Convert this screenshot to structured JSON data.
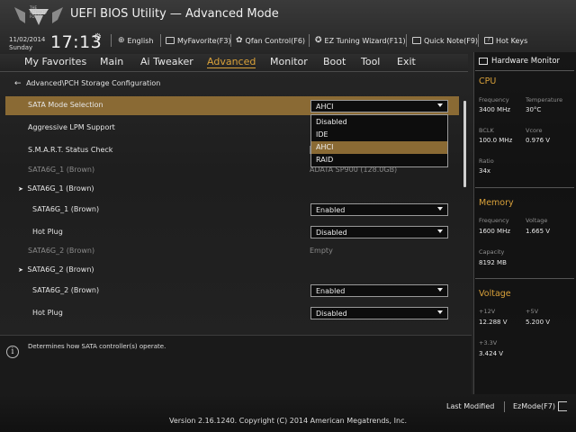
{
  "header": {
    "logo_text": "THE ULTIMATE FORCE",
    "app_title": "UEFI BIOS Utility — Advanced Mode",
    "date": "11/02/2014",
    "day": "Sunday",
    "time": "17:13",
    "items": [
      {
        "icon": "globe-icon",
        "label": "English"
      },
      {
        "icon": "my-favorite-icon",
        "label": "MyFavorite(F3)"
      },
      {
        "icon": "fan-icon",
        "label": "Qfan Control(F6)"
      },
      {
        "icon": "ez-tuning-icon",
        "label": "EZ Tuning Wizard(F11)"
      },
      {
        "icon": "quick-note-icon",
        "label": "Quick Note(F9)"
      },
      {
        "icon": "hot-keys-icon",
        "label": "Hot Keys"
      }
    ]
  },
  "nav": {
    "tabs": [
      "My Favorites",
      "Main",
      "Ai Tweaker",
      "Advanced",
      "Monitor",
      "Boot",
      "Tool",
      "Exit"
    ],
    "active": "Advanced"
  },
  "main": {
    "breadcrumb": "Advanced\\PCH Storage Configuration",
    "rows": [
      {
        "label": "SATA Mode Selection",
        "value": "AHCI"
      },
      {
        "label": "Aggressive LPM Support"
      },
      {
        "label": "S.M.A.R.T. Status Check"
      },
      {
        "label": "SATA6G_1 (Brown)",
        "value": "ADATA SP900 (128.0GB)"
      },
      {
        "label": "SATA6G_1 (Brown)"
      },
      {
        "label": "SATA6G_1 (Brown)",
        "value": "Enabled"
      },
      {
        "label": "Hot Plug",
        "value": "Disabled"
      },
      {
        "label": "SATA6G_2 (Brown)",
        "value": "Empty"
      },
      {
        "label": "SATA6G_2 (Brown)"
      },
      {
        "label": "SATA6G_2 (Brown)",
        "value": "Enabled"
      },
      {
        "label": "Hot Plug",
        "value": "Disabled"
      }
    ],
    "dropdown_options": [
      "Disabled",
      "IDE",
      "AHCI",
      "RAID"
    ],
    "dropdown_selected": "AHCI",
    "help_text": "Determines how SATA controller(s) operate."
  },
  "monitor": {
    "title": "Hardware Monitor",
    "cpu": {
      "title": "CPU",
      "frequency_label": "Frequency",
      "frequency": "3400 MHz",
      "temperature_label": "Temperature",
      "temperature": "30°C",
      "bclk_label": "BCLK",
      "bclk": "100.0 MHz",
      "vcore_label": "Vcore",
      "vcore": "0.976 V",
      "ratio_label": "Ratio",
      "ratio": "34x"
    },
    "memory": {
      "title": "Memory",
      "frequency_label": "Frequency",
      "frequency": "1600 MHz",
      "voltage_label": "Voltage",
      "voltage": "1.665 V",
      "capacity_label": "Capacity",
      "capacity": "8192 MB"
    },
    "voltage": {
      "title": "Voltage",
      "v12_label": "+12V",
      "v12": "12.288 V",
      "v5_label": "+5V",
      "v5": "5.200 V",
      "v33_label": "+3.3V",
      "v33": "3.424 V"
    }
  },
  "footer": {
    "last_modified": "Last Modified",
    "ezmode": "EzMode(F7)",
    "copyright": "Version 2.16.1240. Copyright (C) 2014 American Megatrends, Inc."
  },
  "colors": {
    "accent": "#d9a13a",
    "highlight": "#8a6a34"
  }
}
